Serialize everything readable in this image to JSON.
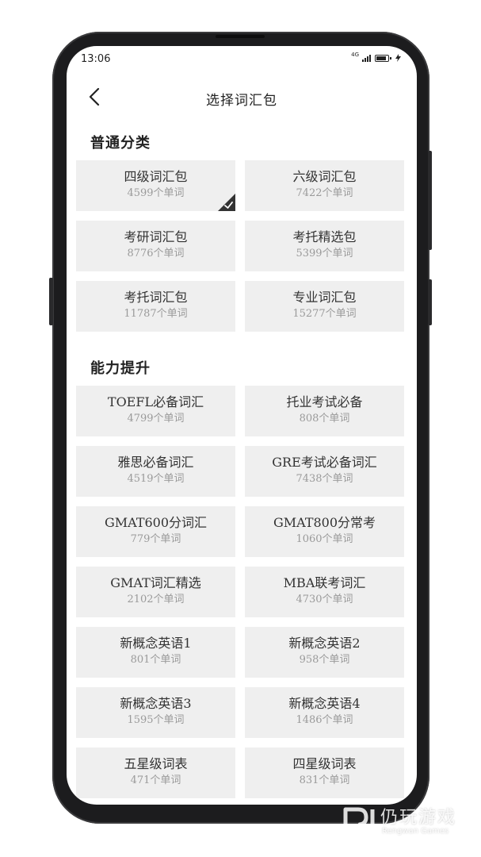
{
  "status_bar": {
    "time": "13:06",
    "network": "4G",
    "icons": [
      "signal-icon",
      "battery-icon",
      "charging-icon"
    ]
  },
  "header": {
    "back_icon": "chevron-left-icon",
    "title": "选择词汇包"
  },
  "sections": [
    {
      "title": "普通分类",
      "items": [
        {
          "name": "四级词汇包",
          "count": "4599个单词",
          "selected": true
        },
        {
          "name": "六级词汇包",
          "count": "7422个单词"
        },
        {
          "name": "考研词汇包",
          "count": "8776个单词"
        },
        {
          "name": "考托精选包",
          "count": "5399个单词"
        },
        {
          "name": "考托词汇包",
          "count": "11787个单词"
        },
        {
          "name": "专业词汇包",
          "count": "15277个单词"
        }
      ]
    },
    {
      "title": "能力提升",
      "items": [
        {
          "name": "TOEFL必备词汇",
          "count": "4799个单词"
        },
        {
          "name": "托业考试必备",
          "count": "808个单词"
        },
        {
          "name": "雅思必备词汇",
          "count": "4519个单词"
        },
        {
          "name": "GRE考试必备词汇",
          "count": "7438个单词"
        },
        {
          "name": "GMAT600分词汇",
          "count": "779个单词"
        },
        {
          "name": "GMAT800分常考",
          "count": "1060个单词"
        },
        {
          "name": "GMAT词汇精选",
          "count": "2102个单词"
        },
        {
          "name": "MBA联考词汇",
          "count": "4730个单词"
        },
        {
          "name": "新概念英语1",
          "count": "801个单词"
        },
        {
          "name": "新概念英语2",
          "count": "958个单词"
        },
        {
          "name": "新概念英语3",
          "count": "1595个单词"
        },
        {
          "name": "新概念英语4",
          "count": "1486个单词"
        },
        {
          "name": "五星级词表",
          "count": "471个单词"
        },
        {
          "name": "四星级词表",
          "count": "831个单词"
        }
      ]
    }
  ],
  "watermark": {
    "cn": "仍玩游戏",
    "en": "Rengwan Games"
  },
  "colors": {
    "card_bg": "#efefef",
    "text_primary": "#333333",
    "text_secondary": "#9a9a9a",
    "check_badge": "#333333"
  }
}
